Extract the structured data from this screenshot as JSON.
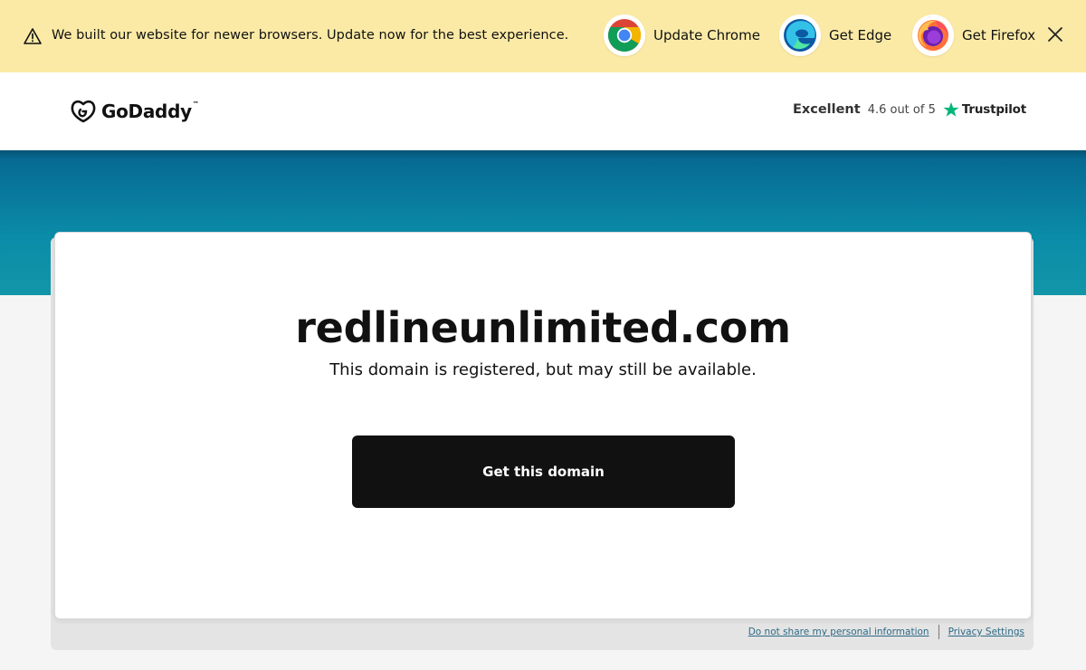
{
  "banner": {
    "message": "We built our website for newer browsers. Update now for the best experience.",
    "browsers": [
      {
        "label": "Update Chrome",
        "icon": "chrome-icon"
      },
      {
        "label": "Get Edge",
        "icon": "edge-icon"
      },
      {
        "label": "Get Firefox",
        "icon": "firefox-icon"
      }
    ],
    "background_color": "#fbeaa6"
  },
  "header": {
    "logo_text": "GoDaddy",
    "logo_tm": "™",
    "rating": {
      "word": "Excellent",
      "score": "4.6 out of 5",
      "brand": "Trustpilot",
      "star_color": "#00b67a"
    }
  },
  "main": {
    "domain": "redlineunlimited.com",
    "subtitle": "This domain is registered, but may still be available.",
    "cta_label": "Get this domain",
    "hero_color": "#0b7fa3"
  },
  "footer": {
    "links": [
      {
        "label": "Do not share my personal information"
      },
      {
        "label": "Privacy Settings"
      }
    ]
  }
}
